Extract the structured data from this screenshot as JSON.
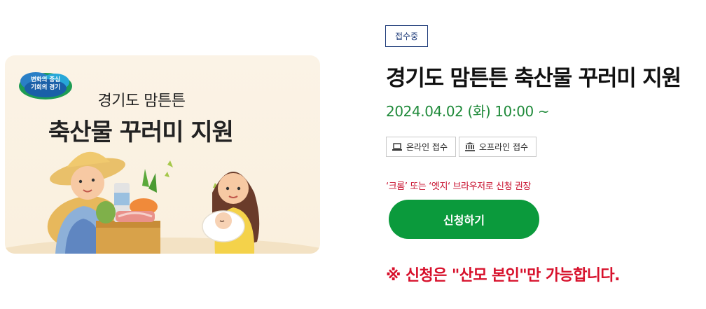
{
  "banner": {
    "logo_line1": "변화의 중심",
    "logo_line2": "기회의 경기",
    "subtitle": "경기도 맘튼튼",
    "title": "축산물 꾸러미 지원"
  },
  "status": {
    "label": "접수중"
  },
  "program": {
    "title": "경기도 맘튼튼 축산물 꾸러미 지원",
    "date": "2024.04.02 (화) 10:00 ~"
  },
  "methods": {
    "online": {
      "label": "온라인 접수",
      "icon": "laptop-icon"
    },
    "offline": {
      "label": "오프라인 접수",
      "icon": "government-building-icon"
    }
  },
  "browser_note": "‘크롬’ 또는 ‘엣지‘ 브라우저로 신청 권장",
  "apply_button": {
    "label": "신청하기"
  },
  "notice": "※ 신청은 \"산모 본인\"만 가능합니다.",
  "colors": {
    "accent_green": "#0b9a3c",
    "date_green": "#1f8a3a",
    "badge_navy": "#1f3c7a",
    "warning_red": "#d7102b"
  }
}
